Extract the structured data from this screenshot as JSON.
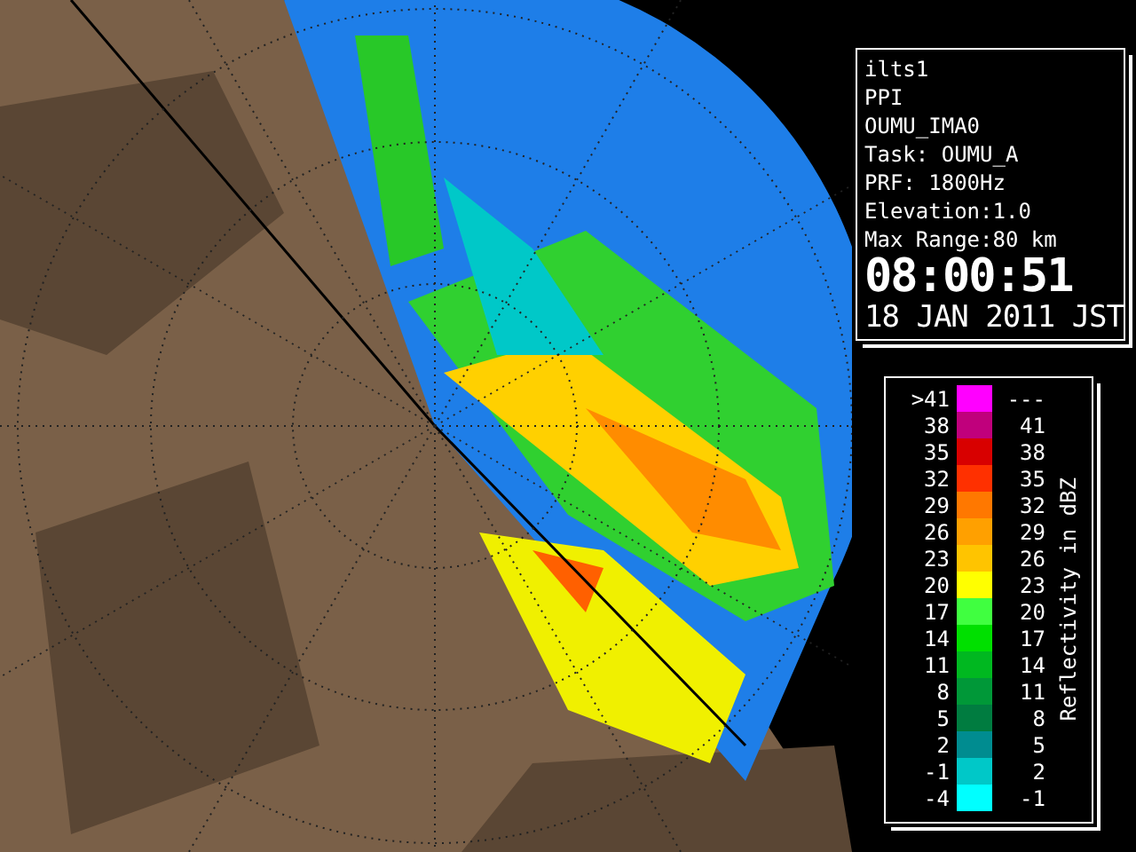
{
  "info": {
    "lines": [
      "ilts1",
      "PPI",
      "OUMU_IMA0",
      "Task: OUMU_A",
      "PRF: 1800Hz",
      "Elevation:1.0",
      "Max Range:80 km"
    ],
    "time": "08:00:51",
    "date": "18 JAN 2011 JST"
  },
  "legend": {
    "title": "Reflectivity in dBZ",
    "rows": [
      {
        "low": ">41",
        "high": "---",
        "color": "#ff00ff"
      },
      {
        "low": "38",
        "high": "41",
        "color": "#c0007c"
      },
      {
        "low": "35",
        "high": "38",
        "color": "#d80000"
      },
      {
        "low": "32",
        "high": "35",
        "color": "#ff3000"
      },
      {
        "low": "29",
        "high": "32",
        "color": "#ff7800"
      },
      {
        "low": "26",
        "high": "29",
        "color": "#ffa000"
      },
      {
        "low": "23",
        "high": "26",
        "color": "#ffc400"
      },
      {
        "low": "20",
        "high": "23",
        "color": "#ffff00"
      },
      {
        "low": "17",
        "high": "20",
        "color": "#40ff40"
      },
      {
        "low": "14",
        "high": "17",
        "color": "#00e000"
      },
      {
        "low": "11",
        "high": "14",
        "color": "#00b820"
      },
      {
        "low": "8",
        "high": "11",
        "color": "#009838"
      },
      {
        "low": "5",
        "high": "8",
        "color": "#007c40"
      },
      {
        "low": "2",
        "high": "5",
        "color": "#008c90"
      },
      {
        "low": "-1",
        "high": "2",
        "color": "#00c8c8"
      },
      {
        "low": "-4",
        "high": "-1",
        "color": "#00ffff"
      }
    ]
  }
}
